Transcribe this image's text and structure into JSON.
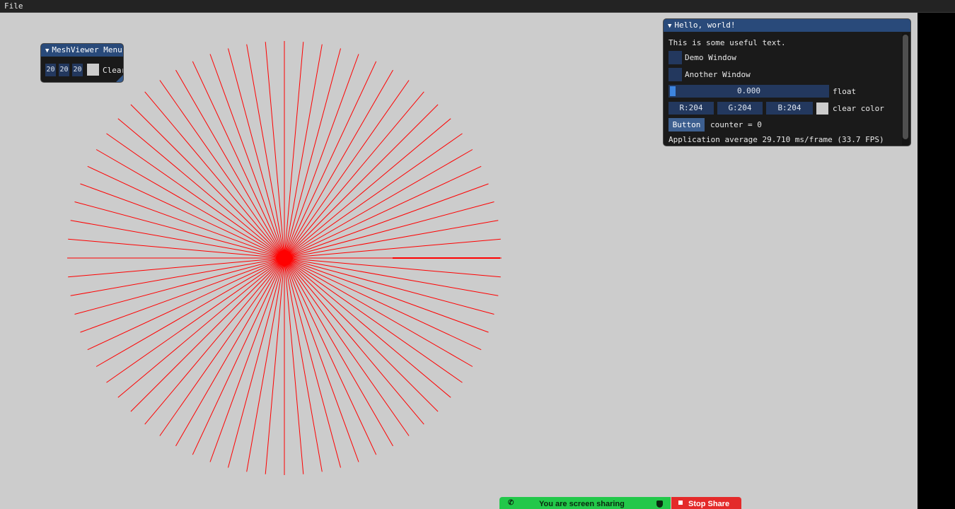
{
  "menu_bar": {
    "file_label": "File"
  },
  "mesh_viewer": {
    "title": "MeshViewer Menu",
    "fields": [
      "20",
      "20",
      "20"
    ],
    "clear_label": "Clear"
  },
  "hello_window": {
    "title": "Hello, world!",
    "text": "This is some useful text.",
    "demo_window_label": "Demo Window",
    "demo_window_checked": false,
    "another_window_label": "Another Window",
    "another_window_checked": false,
    "slider_value": "0.000",
    "slider_fraction": 0.0,
    "slider_label": "float",
    "color_r": "R:204",
    "color_g": "G:204",
    "color_b": "B:204",
    "clear_color_label": "clear color",
    "clear_color_hex": "#cccccc",
    "button_label": "Button",
    "counter_text": "counter = 0",
    "stats_text": "Application average 29.710 ms/frame (33.7 FPS)"
  },
  "canvas": {
    "line_color": "#ff0000",
    "background": "#cccccc",
    "spoke_count": 72
  },
  "screen_share": {
    "status_text": "You are screen sharing",
    "stop_label": "Stop Share",
    "status_color": "#22c84a",
    "stop_color": "#e42a2a"
  }
}
